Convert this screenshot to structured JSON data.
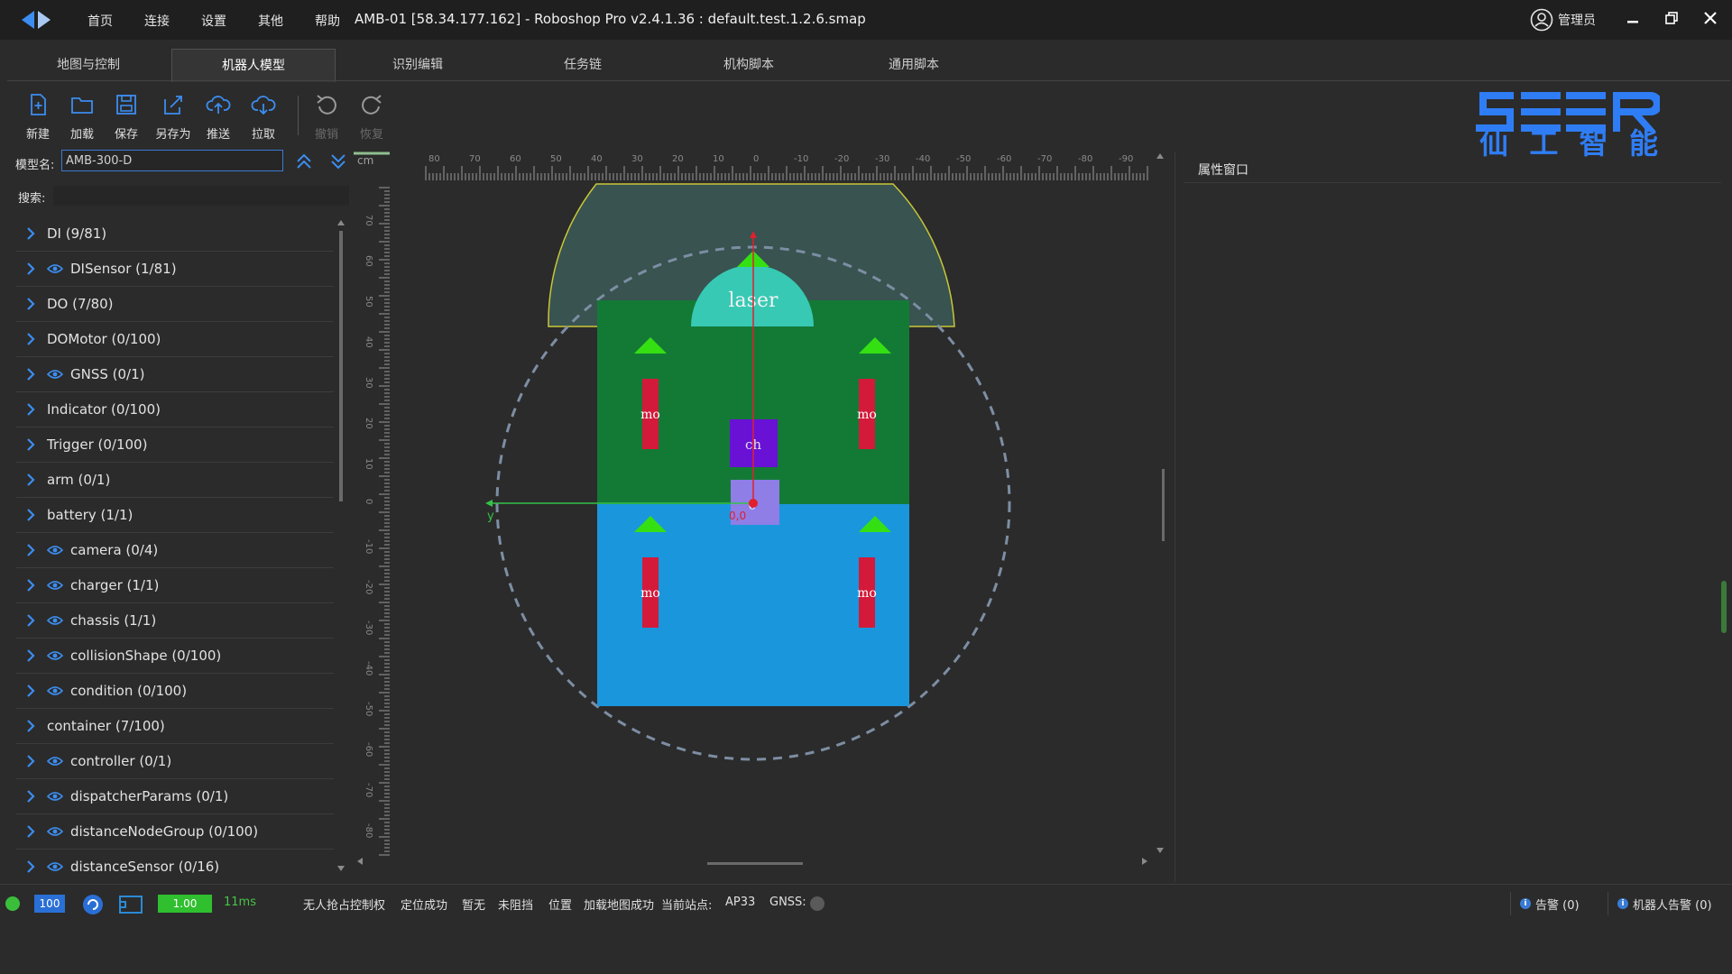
{
  "app": {
    "menu": [
      "首页",
      "连接",
      "设置",
      "其他",
      "帮助"
    ],
    "title": "AMB-01 [58.34.177.162] - Roboshop Pro v2.4.1.36 : default.test.1.2.6.smap",
    "user": "管理员",
    "logo_icon": "arrow-diamond-logo"
  },
  "tabs": [
    {
      "label": "地图与控制",
      "active": false
    },
    {
      "label": "机器人模型",
      "active": true
    },
    {
      "label": "识别编辑",
      "active": false
    },
    {
      "label": "任务链",
      "active": false
    },
    {
      "label": "机构脚本",
      "active": false
    },
    {
      "label": "通用脚本",
      "active": false
    }
  ],
  "toolbar": {
    "new": "新建",
    "load": "加载",
    "save": "保存",
    "save_as": "另存为",
    "push": "推送",
    "pull": "拉取",
    "undo": "撤销",
    "redo": "恢复"
  },
  "brand": {
    "cn": [
      "仙",
      "工",
      "智",
      "能"
    ],
    "accent": "#2f7df5"
  },
  "model": {
    "label": "模型名:",
    "value": "AMB-300-D"
  },
  "search": {
    "label": "搜索:",
    "value": ""
  },
  "tree": [
    {
      "label": "DI (9/81)",
      "eye": false
    },
    {
      "label": "DISensor (1/81)",
      "eye": true
    },
    {
      "label": "DO (7/80)",
      "eye": false
    },
    {
      "label": "DOMotor (0/100)",
      "eye": false
    },
    {
      "label": "GNSS (0/1)",
      "eye": true
    },
    {
      "label": "Indicator (0/100)",
      "eye": false
    },
    {
      "label": "Trigger (0/100)",
      "eye": false
    },
    {
      "label": "arm (0/1)",
      "eye": false
    },
    {
      "label": "battery (1/1)",
      "eye": false
    },
    {
      "label": "camera (0/4)",
      "eye": true
    },
    {
      "label": "charger (1/1)",
      "eye": true
    },
    {
      "label": "chassis (1/1)",
      "eye": true
    },
    {
      "label": "collisionShape (0/100)",
      "eye": true
    },
    {
      "label": "condition (0/100)",
      "eye": true
    },
    {
      "label": "container (7/100)",
      "eye": false
    },
    {
      "label": "controller (0/1)",
      "eye": true
    },
    {
      "label": "dispatcherParams (0/1)",
      "eye": true
    },
    {
      "label": "distanceNodeGroup (0/100)",
      "eye": true
    },
    {
      "label": "distanceSensor (0/16)",
      "eye": true
    }
  ],
  "canvas": {
    "unit": "cm",
    "h_ticks": [
      "80",
      "70",
      "60",
      "50",
      "40",
      "30",
      "20",
      "10",
      "0",
      "-10",
      "-20",
      "-30",
      "-40",
      "-50",
      "-60",
      "-70",
      "-80",
      "-90"
    ],
    "v_ticks": [
      "70",
      "60",
      "50",
      "40",
      "30",
      "20",
      "10",
      "0",
      "-10",
      "-20",
      "-30",
      "-40",
      "-50",
      "-60",
      "-70",
      "-80"
    ],
    "labels": {
      "laser": "laser",
      "controller": "ch",
      "center": "0",
      "origin": "0,0",
      "axis_y": "y",
      "motor": "mo"
    },
    "colors": {
      "front": "#137a36",
      "rear": "#1a96dc",
      "controller": "#6a11d6",
      "motor": "#d41a3a",
      "arrow": "#35e012",
      "laser_dome": "#37c9b4"
    }
  },
  "properties": {
    "title": "属性窗口"
  },
  "status": {
    "battery": "100",
    "speed": "1.00",
    "latency": "11ms",
    "texts": [
      "无人抢占控制权",
      "定位成功",
      "暂无",
      "未阻挡",
      "位置",
      "加载地图成功",
      "当前站点:",
      "AP33",
      "GNSS:"
    ],
    "alarm": "告警 (0)",
    "robot_alarm": "机器人告警 (0)"
  }
}
